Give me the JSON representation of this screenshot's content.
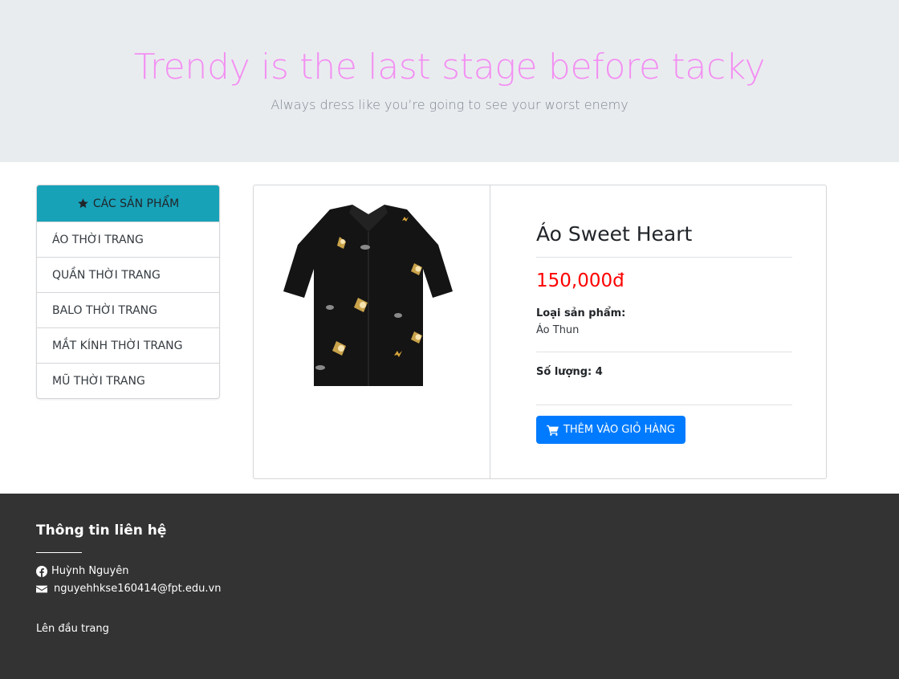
{
  "hero": {
    "title": "Trendy is the last stage before tacky",
    "subtitle": "Always dress like you’re going to see your worst enemy"
  },
  "sidebar": {
    "header": "CÁC SẢN PHẨM",
    "header_icon": "star-icon",
    "items": [
      {
        "label": "ÁO THỜI TRANG"
      },
      {
        "label": "QUẦN THỜI TRANG"
      },
      {
        "label": "BALO THỜI TRANG"
      },
      {
        "label": "MẮT KÍNH THỜI TRANG"
      },
      {
        "label": "MŨ THỜI TRANG"
      }
    ]
  },
  "product": {
    "name": "Áo Sweet Heart",
    "price": "150,000đ",
    "type_label": "Loại sản phẩm:",
    "type_value": "Áo Thun",
    "quantity_text": "Số lượng: 4",
    "add_to_cart_label": "THÊM VÀO GIỎ HÀNG",
    "add_to_cart_icon": "cart-icon"
  },
  "footer": {
    "title": "Thông tin liên hệ",
    "facebook_name": "Huỳnh Nguyên",
    "facebook_icon": "facebook-icon",
    "email": "nguyehhkse160414@fpt.edu.vn",
    "email_icon": "envelope-icon",
    "back_to_top": "Lên đầu trang"
  },
  "colors": {
    "hero_bg": "#e9ecef",
    "hero_title": "#f38ff2",
    "sidebar_header_bg": "#17a2b8",
    "price": "#ff0000",
    "button": "#007bff",
    "footer_bg": "#333333"
  }
}
